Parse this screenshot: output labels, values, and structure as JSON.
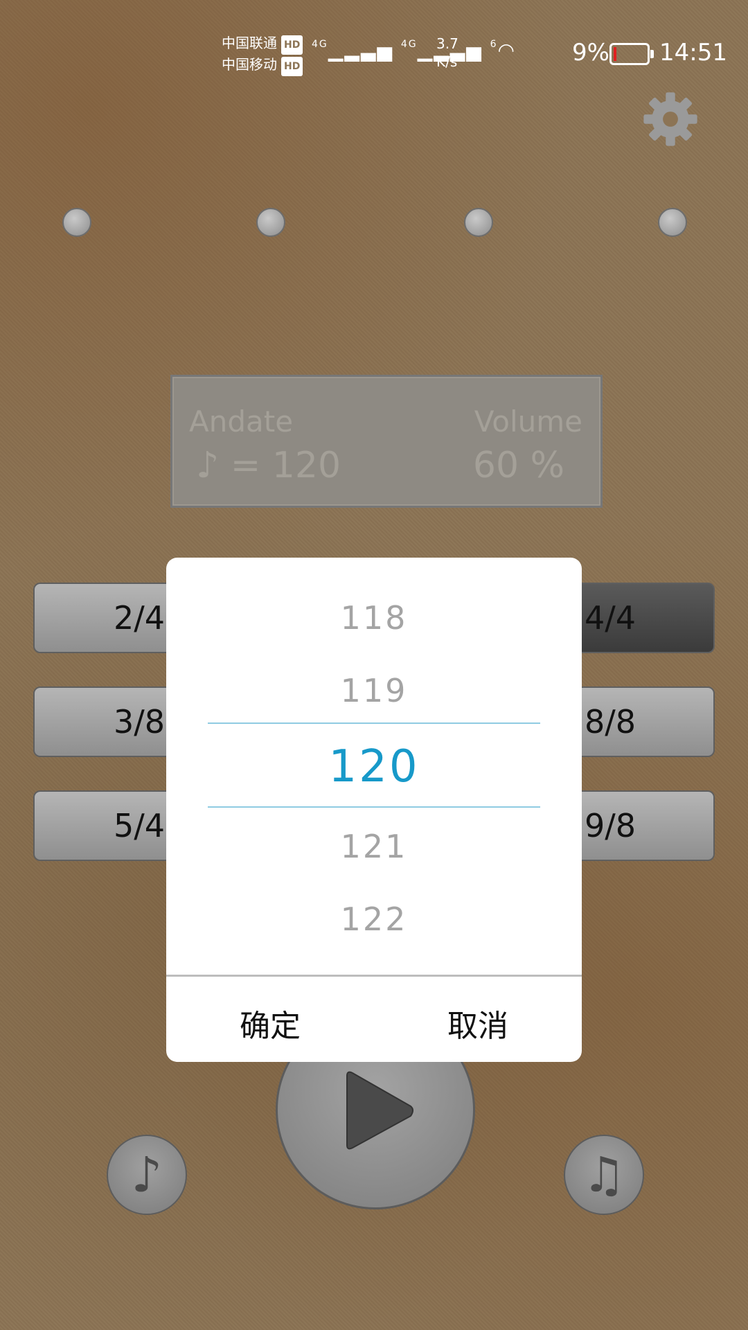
{
  "status_bar": {
    "carrier1": "中国联通",
    "carrier2": "中国移动",
    "hd_badge": "HD",
    "signal1": "4G",
    "signal2": "4G",
    "wifi_label": "6",
    "speed_value": "3.7",
    "speed_unit": "K/s",
    "battery_percent": "9%",
    "time": "14:51",
    "battery_level": 0.09,
    "battery_color": "#e02020"
  },
  "display": {
    "tempo_name": "Andate",
    "tempo_value": "♪ = 120",
    "volume_label": "Volume",
    "volume_value": "60 %"
  },
  "time_signatures": {
    "left": [
      "2/4",
      "3/8",
      "5/4"
    ],
    "right": [
      "4/4",
      "8/8",
      "9/8"
    ],
    "active": "4/4"
  },
  "buttons": {
    "single_note_icon": "♪",
    "double_note_icon": "♫"
  },
  "picker": {
    "items": [
      "118",
      "119",
      "120",
      "121",
      "122"
    ],
    "selected": "120",
    "confirm_label": "确定",
    "cancel_label": "取消",
    "accent_color": "#1799c9"
  }
}
